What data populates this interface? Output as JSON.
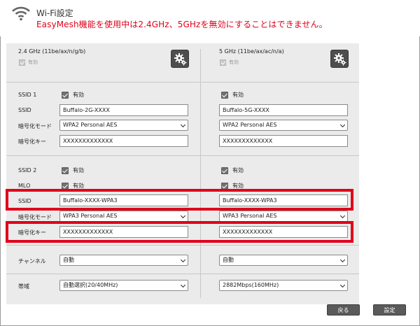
{
  "header": {
    "title": "Wi-Fi設定",
    "warning": "EasyMesh機能を使用中は2.4GHz、5GHzを無効にすることはできません。"
  },
  "band_24": {
    "name": "2.4 GHz (11be/ax/n/g/b)",
    "enabled_label": "有効",
    "ssid1_enabled": "有効",
    "ssid1": "Buffalo-2G-XXXX",
    "ssid1_encryption": "WPA2 Personal AES",
    "ssid1_key": "XXXXXXXXXXXXX",
    "ssid2_enabled": "有効",
    "mlo_enabled": "有効",
    "ssid2": "Buffalo-XXXX-WPA3",
    "ssid2_encryption": "WPA3 Personal AES",
    "ssid2_key": "XXXXXXXXXXXXX",
    "channel": "自動",
    "bandwidth": "自動選択(20/40MHz)"
  },
  "band_5": {
    "name": "5 GHz (11be/ax/ac/n/a)",
    "enabled_label": "有効",
    "ssid1_enabled": "有効",
    "ssid1": "Buffalo-5G-XXXX",
    "ssid1_encryption": "WPA2 Personal AES",
    "ssid1_key": "XXXXXXXXXXXXX",
    "ssid2_enabled": "有効",
    "mlo_enabled": "有効",
    "ssid2": "Buffalo-XXXX-WPA3",
    "ssid2_encryption": "WPA3 Personal AES",
    "ssid2_key": "XXXXXXXXXXXXX",
    "channel": "自動",
    "bandwidth": "2882Mbps(160MHz)"
  },
  "labels": {
    "ssid1": "SSID 1",
    "ssid": "SSID",
    "encryption_mode": "暗号化モード",
    "encryption_key": "暗号化キー",
    "ssid2": "SSID 2",
    "mlo": "MLO",
    "ssid_b": "SSID",
    "encryption_mode_b": "暗号化モード",
    "encryption_key_b": "暗号化キー",
    "channel": "チャンネル",
    "bandwidth": "帯域"
  },
  "buttons": {
    "back": "戻る",
    "apply": "設定"
  },
  "colors": {
    "warning": "#e0001b",
    "highlight": "#e0001b",
    "button": "#5a5a5a"
  }
}
